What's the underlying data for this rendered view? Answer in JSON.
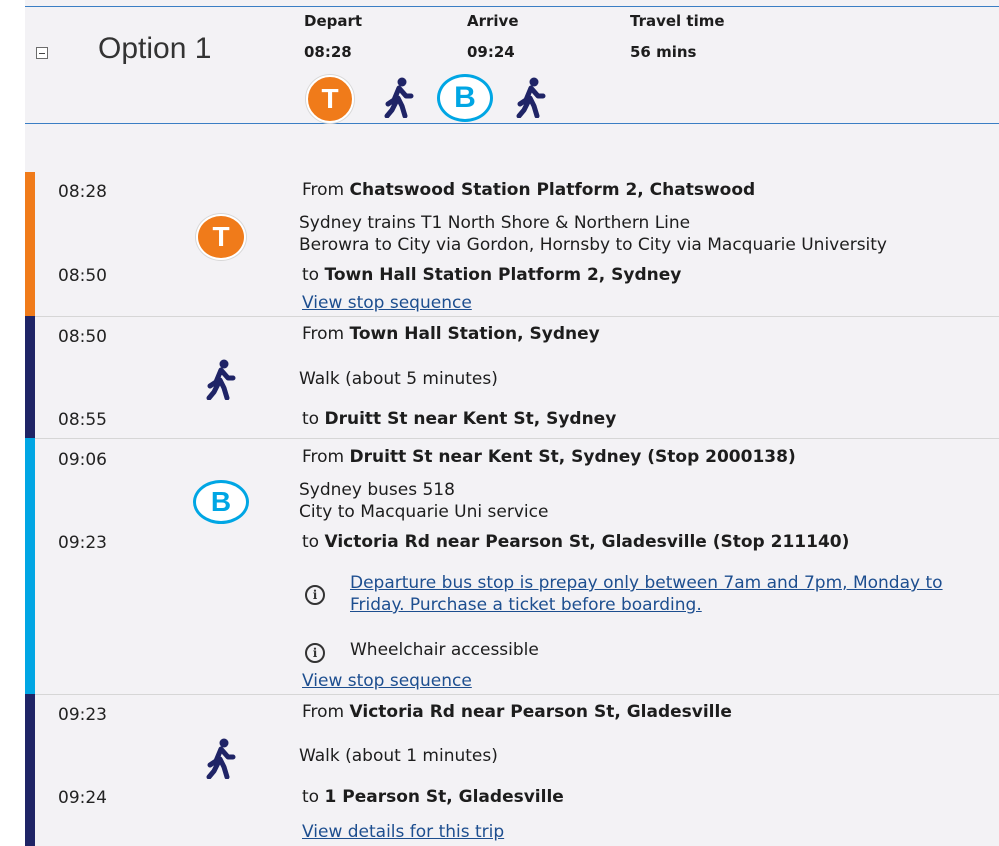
{
  "option": {
    "title": "Option 1"
  },
  "summary": {
    "depart_label": "Depart",
    "depart_time": "08:28",
    "arrive_label": "Arrive",
    "arrive_time": "09:24",
    "travel_label": "Travel time",
    "travel_time": "56 mins",
    "modes": [
      "train-icon",
      "walk-icon",
      "bus-icon",
      "walk-icon"
    ],
    "train_letter": "T",
    "bus_letter": "B"
  },
  "colors": {
    "train": "#f07b1a",
    "walk": "#1f2466",
    "bus": "#00a6e4",
    "link": "#1d4e8f"
  },
  "legs": [
    {
      "type": "train",
      "start_time": "08:28",
      "end_time": "08:50",
      "from_prefix": "From",
      "from": "Chatswood Station Platform 2, Chatswood",
      "desc1": "Sydney trains T1 North Shore & Northern Line",
      "desc2": "Berowra to City via Gordon, Hornsby to City via Macquarie University",
      "to_prefix": "to",
      "to": "Town Hall Station Platform 2, Sydney",
      "link": "View stop sequence"
    },
    {
      "type": "walk",
      "start_time": "08:50",
      "end_time": "08:55",
      "from_prefix": "From",
      "from": "Town Hall Station, Sydney",
      "desc1": "Walk (about 5 minutes)",
      "to_prefix": "to",
      "to": "Druitt St near Kent St, Sydney"
    },
    {
      "type": "bus",
      "start_time": "09:06",
      "end_time": "09:23",
      "from_prefix": "From",
      "from": "Druitt St near Kent St, Sydney (Stop 2000138)",
      "desc1": "Sydney buses 518",
      "desc2": "City to Macquarie Uni service",
      "to_prefix": "to",
      "to": "Victoria Rd near Pearson St, Gladesville (Stop 211140)",
      "notice1_line1": "Departure bus stop is prepay only between 7am and 7pm, Monday to",
      "notice1_line2": "Friday. Purchase a ticket before boarding.",
      "notice2": "Wheelchair accessible",
      "info_glyph": "i",
      "link": "View stop sequence"
    },
    {
      "type": "walk",
      "start_time": "09:23",
      "end_time": "09:24",
      "from_prefix": "From",
      "from": "Victoria Rd near Pearson St, Gladesville",
      "desc1": "Walk (about 1 minutes)",
      "to_prefix": "to",
      "to": "1 Pearson St, Gladesville",
      "link": "View details for this trip"
    }
  ]
}
